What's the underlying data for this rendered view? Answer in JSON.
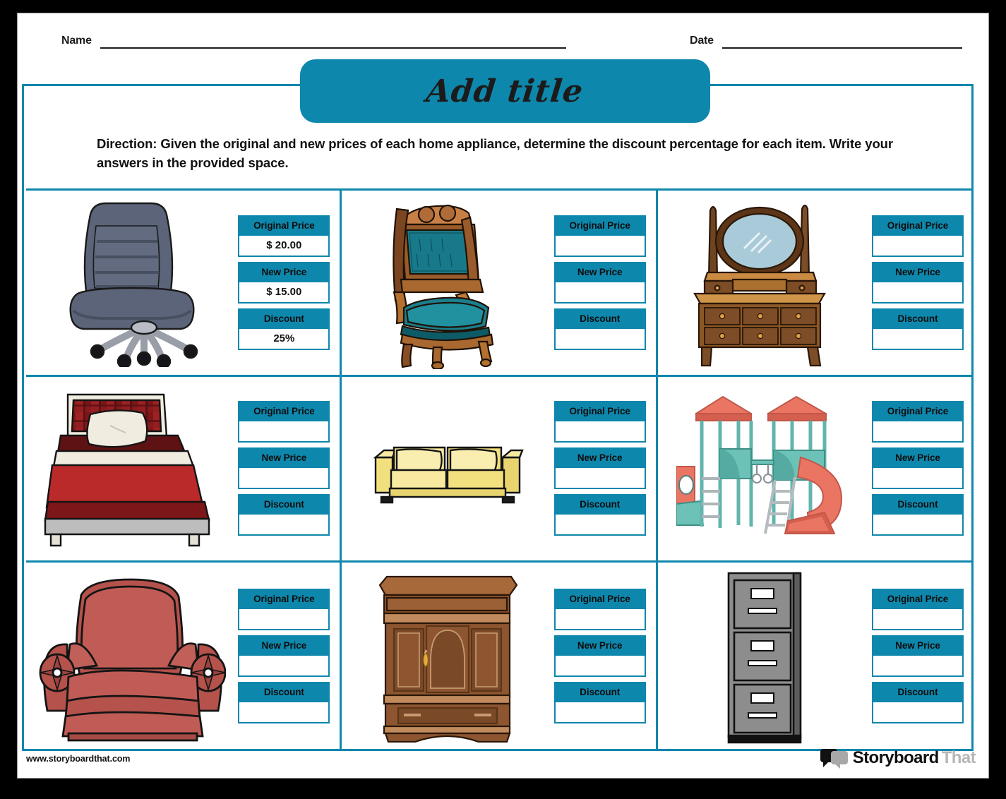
{
  "header": {
    "name_label": "Name",
    "date_label": "Date"
  },
  "title": "Add title",
  "direction": "Direction: Given the original and new prices of each home appliance, determine the discount percentage for each item. Write your answers in the provided space.",
  "labels": {
    "original_price": "Original Price",
    "new_price": "New Price",
    "discount": "Discount"
  },
  "footer": {
    "url": "www.storyboardthat.com",
    "logo_primary": "Storyboard",
    "logo_secondary": "That"
  },
  "colors": {
    "accent_teal": "#0e87ac",
    "ink": "#111111",
    "page_background": "#ffffff",
    "canvas_background": "#000000"
  },
  "items": [
    {
      "icon": "office-chair-icon",
      "name": "office-chair",
      "original_price": "$ 20.00",
      "new_price": "$ 15.00",
      "discount": "25%"
    },
    {
      "icon": "antique-chair-icon",
      "name": "antique-chair",
      "original_price": "",
      "new_price": "",
      "discount": ""
    },
    {
      "icon": "vanity-dresser-icon",
      "name": "vanity-dresser",
      "original_price": "",
      "new_price": "",
      "discount": ""
    },
    {
      "icon": "bed-icon",
      "name": "bed",
      "original_price": "",
      "new_price": "",
      "discount": ""
    },
    {
      "icon": "sofa-icon",
      "name": "sofa",
      "original_price": "",
      "new_price": "",
      "discount": ""
    },
    {
      "icon": "playground-icon",
      "name": "playground",
      "original_price": "",
      "new_price": "",
      "discount": ""
    },
    {
      "icon": "recliner-icon",
      "name": "recliner",
      "original_price": "",
      "new_price": "",
      "discount": ""
    },
    {
      "icon": "armoire-icon",
      "name": "armoire",
      "original_price": "",
      "new_price": "",
      "discount": ""
    },
    {
      "icon": "filing-cabinet-icon",
      "name": "filing-cabinet",
      "original_price": "",
      "new_price": "",
      "discount": ""
    }
  ]
}
